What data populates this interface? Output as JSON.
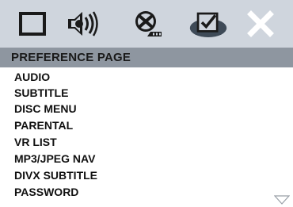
{
  "toolbar": {
    "icons": [
      {
        "name": "general-setup-icon",
        "selected": false
      },
      {
        "name": "audio-setup-icon",
        "selected": false
      },
      {
        "name": "video-setup-icon",
        "selected": false
      },
      {
        "name": "preference-setup-icon",
        "selected": true
      },
      {
        "name": "exit-icon",
        "selected": false
      }
    ]
  },
  "header": {
    "title": "PREFERENCE PAGE"
  },
  "menu": {
    "items": [
      {
        "label": "AUDIO"
      },
      {
        "label": "SUBTITLE"
      },
      {
        "label": "DISC MENU"
      },
      {
        "label": "PARENTAL"
      },
      {
        "label": "VR LIST"
      },
      {
        "label": "MP3/JPEG NAV"
      },
      {
        "label": "DIVX SUBTITLE"
      },
      {
        "label": "PASSWORD"
      }
    ]
  },
  "colors": {
    "toolbar_bg": "#cfd5dd",
    "header_bg": "#8e96a0",
    "selected_icon_bg": "#3e4a57"
  }
}
